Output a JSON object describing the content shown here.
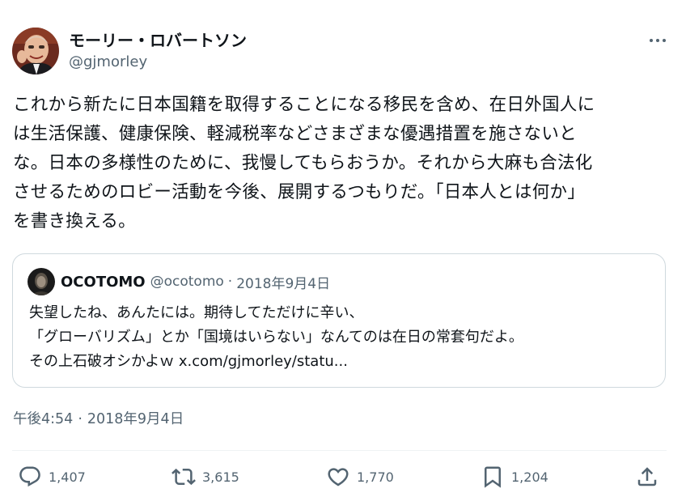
{
  "author": {
    "display_name": "モーリー・ロバートソン",
    "handle": "@gjmorley"
  },
  "tweet": {
    "text_lines": [
      "これから新たに日本国籍を取得することになる移民を含め、在日外国人に",
      "は生活保護、健康保険、軽減税率などさまざまな優遇措置を施さないと",
      "な。日本の多様性のために、我慢してもらおうか。それから大麻も合法化",
      "させるためのロビー活動を今後、展開するつもりだ。「日本人とは何か」",
      "を書き換える。"
    ],
    "time": "午後4:54",
    "separator": "·",
    "date": "2018年9月4日"
  },
  "quote": {
    "display_name": "OCOTOMO",
    "handle": "@ocotomo",
    "separator": "·",
    "date": "2018年9月4日",
    "text_lines": [
      "失望したね、あんたには。期待してただけに辛い、",
      "「グローバリズム」とか「国境はいらない」なんてのは在日の常套句だよ。",
      "その上石破オシかよｗ x.com/gjmorley/statu..."
    ]
  },
  "actions": {
    "reply": {
      "icon": "reply-icon",
      "count": "1,407"
    },
    "retweet": {
      "icon": "retweet-icon",
      "count": "3,615"
    },
    "like": {
      "icon": "heart-icon",
      "count": "1,770"
    },
    "bookmark": {
      "icon": "bookmark-icon",
      "count": "1,204"
    },
    "share": {
      "icon": "share-icon"
    }
  },
  "colors": {
    "text_primary": "#0f1419",
    "text_secondary": "#536471",
    "border": "#cfd9de",
    "divider": "#eff3f4"
  }
}
